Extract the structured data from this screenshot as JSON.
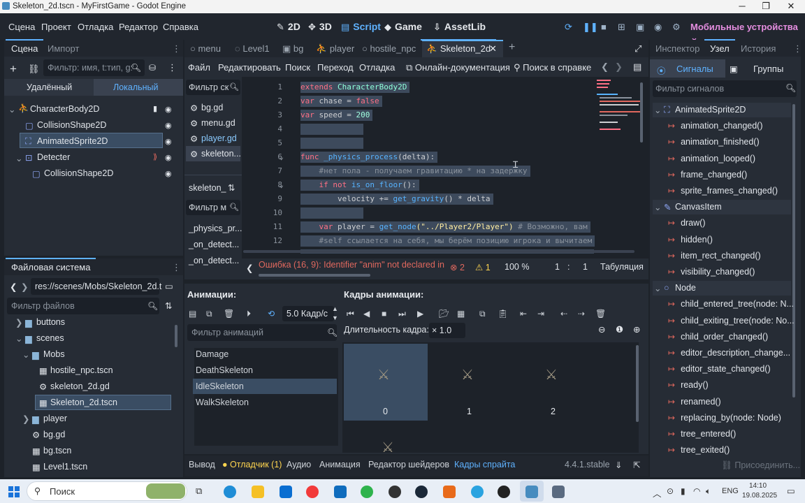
{
  "window": {
    "title": "Skeleton_2d.tscn - MyFirstGame - Godot Engine",
    "min": "─",
    "max": "❐",
    "close": "✕"
  },
  "menu": [
    "Сцена",
    "Проект",
    "Отладка",
    "Редактор",
    "Справка"
  ],
  "workspaces": [
    "2D",
    "3D",
    "Script",
    "Game",
    "AssetLib"
  ],
  "active_workspace": "Script",
  "renderer": "Мобильные устройства",
  "scene_dock": {
    "tabs": [
      "Сцена",
      "Импорт"
    ],
    "filter_placeholder": "Фильтр: имя, t:тип, g:",
    "sub_tabs": [
      "Удалённый",
      "Локальный"
    ],
    "nodes": [
      "CharacterBody2D",
      "CollisionShape2D",
      "AnimatedSprite2D",
      "Detecter",
      "CollisionShape2D"
    ],
    "selected": "AnimatedSprite2D"
  },
  "fs_dock": {
    "title": "Файловая система",
    "path": "res://scenes/Mobs/Skeleton_2d.t",
    "filter_placeholder": "Фильтр файлов",
    "items": [
      "buttons",
      "scenes",
      "Mobs",
      "hostile_npc.tscn",
      "skeleton_2d.gd",
      "Skeleton_2d.tscn",
      "player",
      "bg.gd",
      "bg.tscn",
      "Level1.tscn"
    ],
    "selected": "Skeleton_2d.tscn"
  },
  "editor_tabs": [
    "menu",
    "Level1",
    "bg",
    "player",
    "hostile_npc",
    "Skeleton_2d"
  ],
  "active_tab": "Skeleton_2d",
  "script_menu": [
    "Файл",
    "Редактировать",
    "Поиск",
    "Переход",
    "Отладка"
  ],
  "online_docs": "Онлайн-документация",
  "search_help": "Поиск в справке",
  "script_list": {
    "filter_placeholder": "Фильтр ск",
    "files": [
      "bg.gd",
      "menu.gd",
      "player.gd",
      "skeleton..."
    ],
    "current": "skeleton_",
    "method_filter": "Фильтр м",
    "methods": [
      "_physics_pr...",
      "_on_detect...",
      "_on_detect..."
    ]
  },
  "code": {
    "line_numbers": [
      "1",
      "2",
      "3",
      "4",
      "5",
      "6",
      "7",
      "8",
      "9",
      "10",
      "11",
      "12"
    ],
    "lines": [
      [
        [
          "kw",
          "extends"
        ],
        [
          "df",
          " "
        ],
        [
          "ty",
          "CharacterBody2D"
        ]
      ],
      [
        [
          "kw",
          "var"
        ],
        [
          "df",
          " chase = "
        ],
        [
          "kw",
          "false"
        ]
      ],
      [
        [
          "kw",
          "var"
        ],
        [
          "df",
          " speed = "
        ],
        [
          "nm",
          "200"
        ]
      ],
      [],
      [],
      [
        [
          "kw",
          "func"
        ],
        [
          "df",
          " "
        ],
        [
          "fn",
          "_physics_process"
        ],
        [
          "df",
          "(delta):"
        ]
      ],
      [
        [
          "cm",
          "    #нет пола - получаем гравитацию * на задержку"
        ]
      ],
      [
        [
          "df",
          "    "
        ],
        [
          "kw",
          "if not"
        ],
        [
          "df",
          " "
        ],
        [
          "fn",
          "is_on_floor"
        ],
        [
          "df",
          "():"
        ]
      ],
      [
        [
          "df",
          "        velocity += "
        ],
        [
          "fn",
          "get_gravity"
        ],
        [
          "df",
          "() * delta"
        ]
      ],
      [],
      [
        [
          "df",
          "    "
        ],
        [
          "kw",
          "var"
        ],
        [
          "df",
          " player = "
        ],
        [
          "fn",
          "get_node"
        ],
        [
          "st",
          "(\"../Player2/Player\")"
        ],
        [
          "cm",
          " # Возможно, вам"
        ]
      ],
      [
        [
          "cm",
          "    #self ссылается на себя, мы берём позицию игрока и вычитаем"
        ]
      ]
    ]
  },
  "status": {
    "error": "Ошибка (16, 9): Identifier \"anim\" not declared in th",
    "errors": "2",
    "warnings": "1",
    "zoom": "100 %",
    "line": "1",
    "col": "1",
    "indent": "Табуляция"
  },
  "inspector": {
    "tabs": [
      "Инспектор",
      "Узел",
      "История"
    ],
    "sub_tabs": [
      "Сигналы",
      "Группы"
    ],
    "filter_placeholder": "Фильтр сигналов",
    "groups": [
      {
        "name": "AnimatedSprite2D",
        "signals": [
          "animation_changed()",
          "animation_finished()",
          "animation_looped()",
          "frame_changed()",
          "sprite_frames_changed()"
        ]
      },
      {
        "name": "CanvasItem",
        "signals": [
          "draw()",
          "hidden()",
          "item_rect_changed()",
          "visibility_changed()"
        ]
      },
      {
        "name": "Node",
        "signals": [
          "child_entered_tree(node: N...",
          "child_exiting_tree(node: No...",
          "child_order_changed()",
          "editor_description_change...",
          "editor_state_changed()",
          "ready()",
          "renamed()",
          "replacing_by(node: Node)",
          "tree_entered()",
          "tree_exited()"
        ]
      }
    ],
    "connect": "Присоединить..."
  },
  "sprite_frames": {
    "anim_title": "Анимации:",
    "frames_title": "Кадры анимации:",
    "fps": "5.0 Кадр/с",
    "filter_placeholder": "Фильтр анимаций",
    "duration_label": "Длительность кадра:",
    "duration": "× 1.0",
    "animations": [
      "Damage",
      "DeathSkeleton",
      "IdleSkeleton",
      "WalkSkeleton"
    ],
    "selected": "IdleSkeleton",
    "frames": [
      "0",
      "1",
      "2"
    ]
  },
  "bottom_tabs": [
    "Вывод",
    "Отладчик (1)",
    "Аудио",
    "Анимация",
    "Редактор шейдеров",
    "Кадры спрайта"
  ],
  "version": "4.4.1.stable",
  "taskbar": {
    "search": "Поиск",
    "lang": "ENG",
    "time": "14:10",
    "date": "19.08.2025"
  },
  "colors": {
    "accent": "#5fb2ff",
    "mobile": "#e58ee0",
    "error": "#e0685e",
    "warning": "#ffd54f"
  }
}
